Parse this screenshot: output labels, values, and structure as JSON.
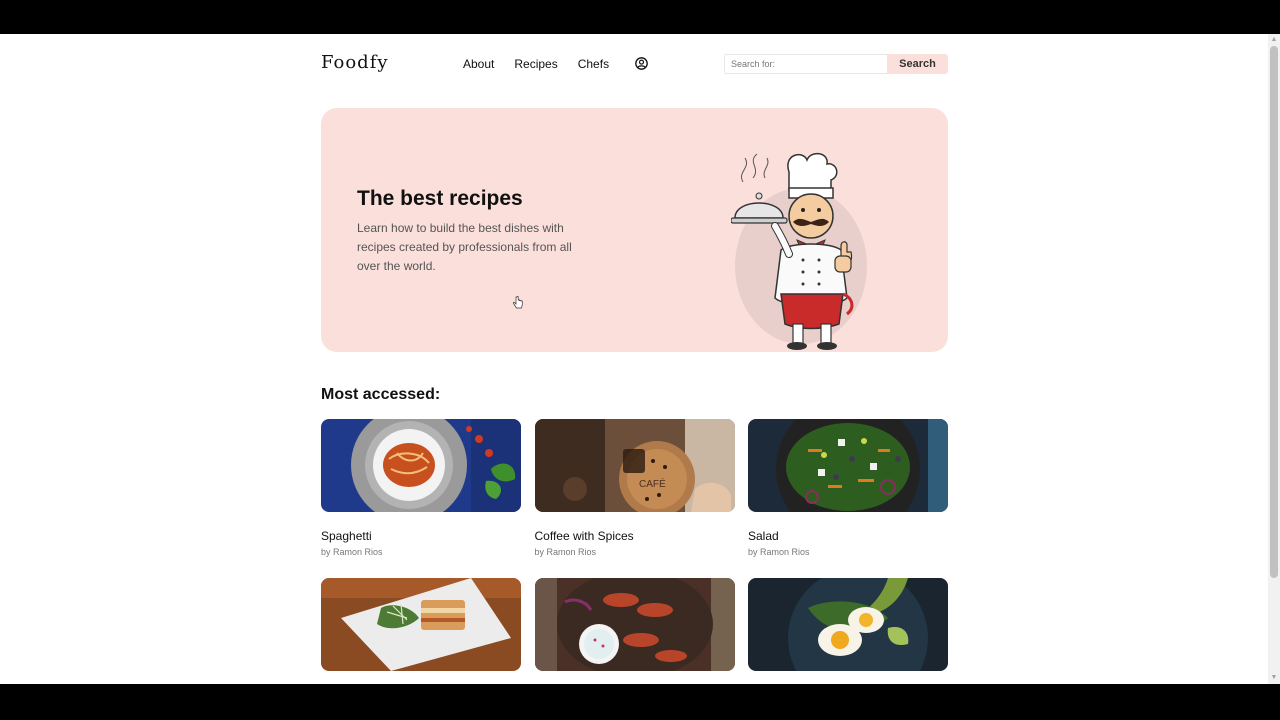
{
  "header": {
    "logo": "Foodfy",
    "nav": [
      "About",
      "Recipes",
      "Chefs"
    ],
    "user_icon": "user-circle-icon",
    "search": {
      "placeholder": "Search for:",
      "button": "Search"
    }
  },
  "hero": {
    "title": "The best recipes",
    "text": "Learn how to build the best dishes with recipes created by professionals from all over the world.",
    "illustration": "chef-illustration"
  },
  "section": {
    "title": "Most accessed:"
  },
  "recipes": [
    {
      "name": "Spaghetti",
      "author": "by Ramon Rios"
    },
    {
      "name": "Coffee with Spices",
      "author": "by Ramon Rios"
    },
    {
      "name": "Salad",
      "author": "by Ramon Rios"
    },
    {
      "name": "",
      "author": ""
    },
    {
      "name": "",
      "author": ""
    },
    {
      "name": "",
      "author": ""
    }
  ],
  "colors": {
    "accent": "#fbdfdb",
    "text": "#111111",
    "muted": "#777777"
  }
}
